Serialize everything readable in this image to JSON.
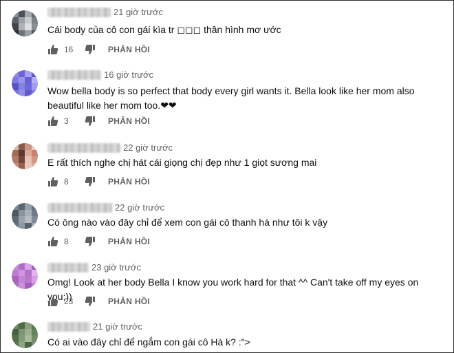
{
  "comments": [
    {
      "author": "",
      "time": "21 giờ trước",
      "text": "Cái body của cô con gái kìa tr ◻◻◻ thân hình mơ ước",
      "likes": "16",
      "reply_label": "PHẢN HỒI",
      "avatar_colors": [
        "#8a8f96",
        "#4b5058",
        "#a4a9ad",
        "#6a7076",
        "#5b6168",
        "#9aa0a4",
        "#c9ccce",
        "#7d8288",
        "#3f444b",
        "#b0b3b6",
        "#dcdedf",
        "#888d92",
        "#2e3238",
        "#6f747a",
        "#9b9fa3",
        "#555a60"
      ]
    },
    {
      "author": "",
      "time": "16 giờ trước",
      "text": "Wow bella body is so perfect that body every girl wants it. Bella look like her mom also beautiful like her mom too.❤❤",
      "likes": "3",
      "reply_label": "PHẢN HỒI",
      "avatar_colors": [
        "#8f8be0",
        "#6b66d6",
        "#a9a4ee",
        "#5c57cb",
        "#7e79e2",
        "#9a95ea",
        "#6660d4",
        "#b5b1f2",
        "#5953c6",
        "#8883e0",
        "#6d68d9",
        "#a29ded",
        "#7771dc",
        "#938ee6",
        "#5f59cc",
        "#827de1"
      ]
    },
    {
      "author": "",
      "time": "22 giờ trước",
      "text": "E rất thích nghe chị hát cái giọng chị đẹp như 1 giọt sương mai",
      "likes": "8",
      "reply_label": "PHẢN HỒI",
      "avatar_colors": [
        "#d9b7a8",
        "#8c5a4a",
        "#c69684",
        "#e7cdbf",
        "#a36b58",
        "#5b3a30",
        "#e0a896",
        "#c8826e",
        "#b47a66",
        "#704438",
        "#e9c2b0",
        "#d09783",
        "#c48a78",
        "#9a604e",
        "#eac9bb",
        "#dba797"
      ]
    },
    {
      "author": "",
      "time": "22 giờ trước",
      "text": "Có ông nào vào đây chỉ để xem con gái cô thanh hà như tôi k vậy",
      "likes": "8",
      "reply_label": "PHẢN HỒI",
      "avatar_colors": [
        "#7c8792",
        "#5b6672",
        "#96a0a9",
        "#6a7581",
        "#4d5863",
        "#8a949e",
        "#a8b0b7",
        "#707b86",
        "#5f6a75",
        "#9aa3ab",
        "#b6bcc2",
        "#7f8a94",
        "#66717c",
        "#8f99a2",
        "#56616c",
        "#a0a8b0"
      ]
    },
    {
      "author": "",
      "time": "23 giờ trước",
      "text": "Omg! Look at her body Bella I know you work hard for that ^^ Can't take off my eyes on you;))",
      "likes": "23",
      "reply_label": "PHẢN HỒI",
      "avatar_colors": [
        "#c98bd9",
        "#b06cc6",
        "#d9a4e4",
        "#a35fbd",
        "#bf7dd1",
        "#d196df",
        "#b372c9",
        "#e0b3e9",
        "#a966c0",
        "#c485d6",
        "#b978cd",
        "#d69fe2",
        "#ae6ac4",
        "#cb90da",
        "#a25cbb",
        "#c182d4"
      ]
    },
    {
      "author": "",
      "time": "21 giờ trước",
      "text": "Có ai vào đây chỉ để ngắm con gái cô Hà k? :\">",
      "likes": "",
      "reply_label": "",
      "avatar_colors": [
        "#6f8a63",
        "#4f6b45",
        "#8aa37e",
        "#5e7a54",
        "#46623d",
        "#7c9670",
        "#9ab08f",
        "#678260",
        "#54704b",
        "#839c77",
        "#a7bb9c",
        "#718c66",
        "#5a7651",
        "#8ea682",
        "#4b6742",
        "#7a9470"
      ]
    }
  ]
}
